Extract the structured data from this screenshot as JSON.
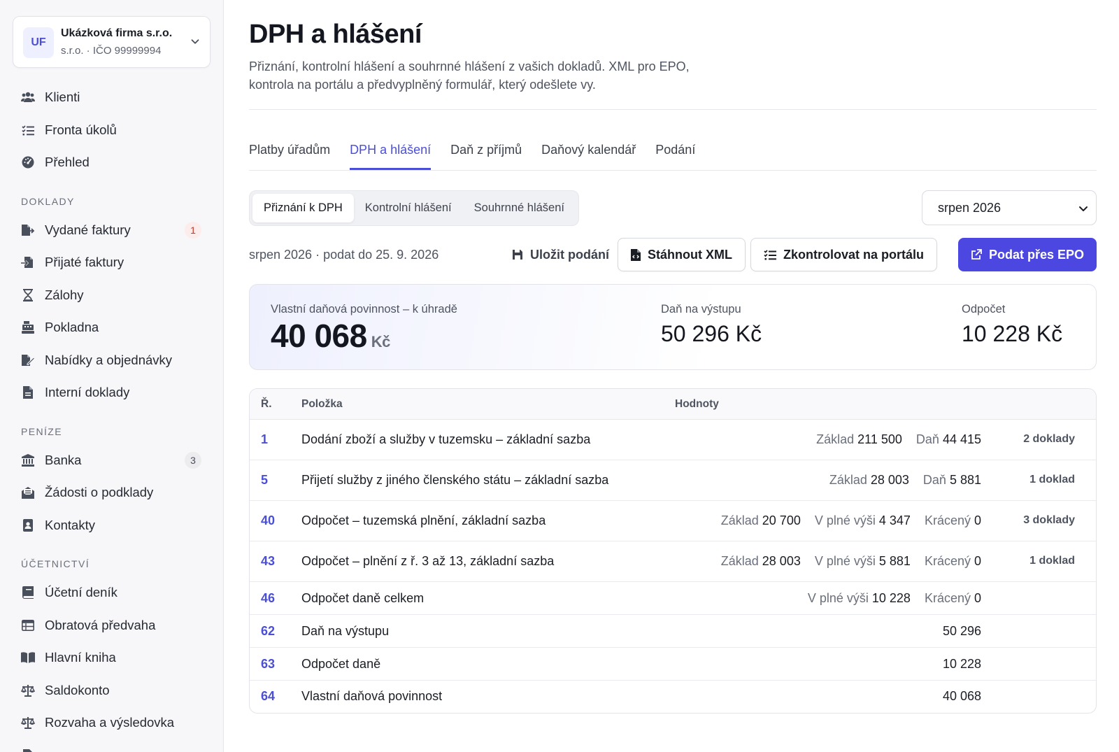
{
  "org": {
    "initials": "UF",
    "name": "Ukázková firma s.r.o.",
    "sub": "s.r.o. · IČO 99999994"
  },
  "nav": {
    "top": [
      {
        "label": "Klienti",
        "icon": "users-icon"
      },
      {
        "label": "Fronta úkolů",
        "icon": "task-list-icon"
      },
      {
        "label": "Přehled",
        "icon": "gauge-icon"
      }
    ],
    "sections": [
      {
        "title": "DOKLADY",
        "items": [
          {
            "label": "Vydané faktury",
            "icon": "file-export-icon",
            "badge": "1"
          },
          {
            "label": "Přijaté faktury",
            "icon": "file-import-icon"
          },
          {
            "label": "Zálohy",
            "icon": "hourglass-icon"
          },
          {
            "label": "Pokladna",
            "icon": "cash-register-icon"
          },
          {
            "label": "Nabídky a objednávky",
            "icon": "file-signature-icon"
          },
          {
            "label": "Interní doklady",
            "icon": "file-text-icon"
          }
        ]
      },
      {
        "title": "PENÍZE",
        "items": [
          {
            "label": "Banka",
            "icon": "bank-icon",
            "badge": "3"
          },
          {
            "label": "Žádosti o podklady",
            "icon": "envelope-open-icon"
          },
          {
            "label": "Kontakty",
            "icon": "address-book-icon"
          }
        ]
      },
      {
        "title": "ÚČETNICTVÍ",
        "items": [
          {
            "label": "Účetní deník",
            "icon": "book-icon"
          },
          {
            "label": "Obratová předvaha",
            "icon": "table-icon"
          },
          {
            "label": "Hlavní kniha",
            "icon": "book-open-icon"
          },
          {
            "label": "Saldokonto",
            "icon": "scale-icon"
          },
          {
            "label": "Rozvaha a výsledovka",
            "icon": "scale-balanced-icon"
          }
        ]
      }
    ]
  },
  "page": {
    "title": "DPH a hlášení",
    "desc": "Přiznání, kontrolní hlášení a souhrnné hlášení z vašich dokladů. XML pro EPO, kontrola na portálu a předvyplněný formulář, který odešlete vy."
  },
  "tabs": [
    "Platby úřadům",
    "DPH a hlášení",
    "Daň z příjmů",
    "Daňový kalendář",
    "Podání"
  ],
  "active_tab": 1,
  "subtabs": [
    "Přiznání k DPH",
    "Kontrolní hlášení",
    "Souhrnné hlášení"
  ],
  "period": "srpen 2026",
  "deadline": "srpen 2026 · podat do 25. 9. 2026",
  "actions": {
    "save": "Uložit podání",
    "download": "Stáhnout XML",
    "check": "Zkontrolovat na portálu",
    "submit": "Podat přes EPO"
  },
  "summary": {
    "main_label": "Vlastní daňová povinnost – k úhradě",
    "main_value": "40 068",
    "main_unit": "Kč",
    "out_label": "Daň na výstupu",
    "out_value": "50 296 Kč",
    "ded_label": "Odpočet",
    "ded_value": "10 228 Kč"
  },
  "table": {
    "headers": {
      "num": "Ř.",
      "item": "Položka",
      "values": "Hodnoty"
    },
    "rows": [
      {
        "num": "1",
        "item": "Dodání zboží a služby v tuzemsku – základní sazba",
        "values": [
          [
            "Základ",
            "211 500"
          ],
          [
            "Daň",
            "44 415"
          ]
        ],
        "docs": "2 doklady"
      },
      {
        "num": "5",
        "item": "Přijetí služby z jiného členského státu – základní sazba",
        "values": [
          [
            "Základ",
            "28 003"
          ],
          [
            "Daň",
            "5 881"
          ]
        ],
        "docs": "1 doklad"
      },
      {
        "num": "40",
        "item": "Odpočet – tuzemská plnění, základní sazba",
        "values": [
          [
            "Základ",
            "20 700"
          ],
          [
            "V plné výši",
            "4 347"
          ],
          [
            "Krácený",
            "0"
          ]
        ],
        "docs": "3 doklady"
      },
      {
        "num": "43",
        "item": "Odpočet – plnění z ř. 3 až 13, základní sazba",
        "values": [
          [
            "Základ",
            "28 003"
          ],
          [
            "V plné výši",
            "5 881"
          ],
          [
            "Krácený",
            "0"
          ]
        ],
        "docs": "1 doklad"
      },
      {
        "num": "46",
        "item": "Odpočet daně celkem",
        "values": [
          [
            "V plné výši",
            "10 228"
          ],
          [
            "Krácený",
            "0"
          ]
        ],
        "docs": ""
      },
      {
        "num": "62",
        "item": "Daň na výstupu",
        "values": [
          [
            "",
            "50 296"
          ]
        ],
        "docs": ""
      },
      {
        "num": "63",
        "item": "Odpočet daně",
        "values": [
          [
            "",
            "10 228"
          ]
        ],
        "docs": ""
      },
      {
        "num": "64",
        "item": "Vlastní daňová povinnost",
        "values": [
          [
            "",
            "40 068"
          ]
        ],
        "docs": ""
      }
    ]
  },
  "colors": {
    "accent": "#4b4fd6",
    "primary_button": "#4b47e0",
    "badge_red": "#c0392b"
  }
}
